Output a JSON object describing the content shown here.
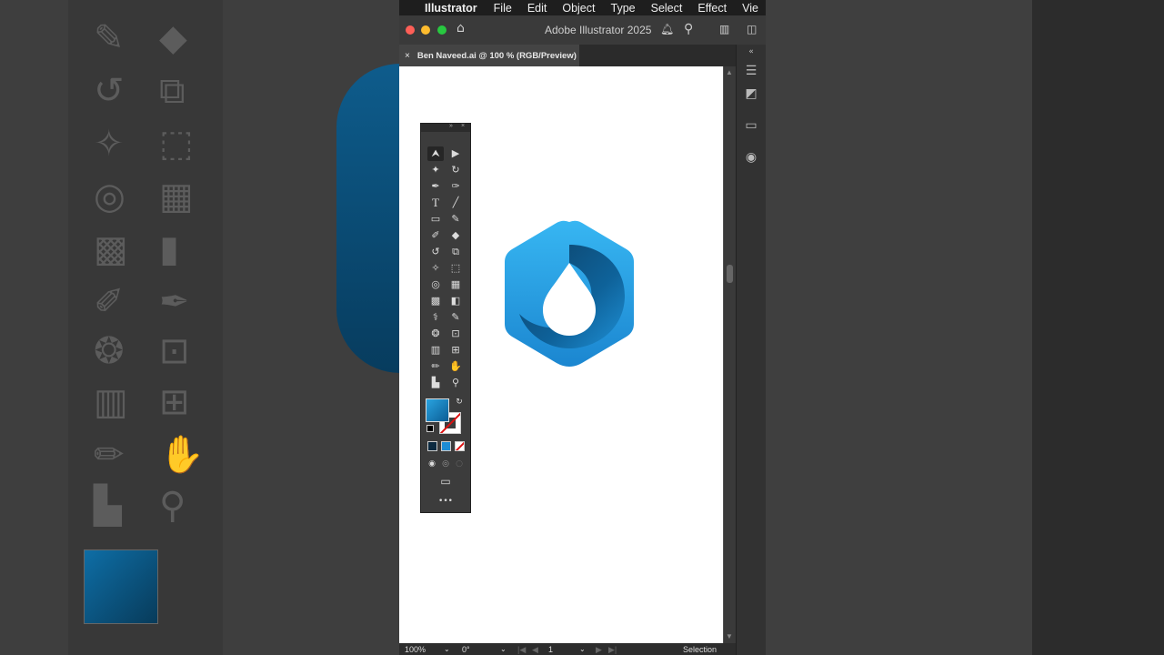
{
  "menubar": {
    "app_name": "Illustrator",
    "items": [
      "File",
      "Edit",
      "Object",
      "Type",
      "Select",
      "Effect",
      "Vie"
    ]
  },
  "window": {
    "title": "Adobe Illustrator 2025",
    "icons": [
      "home-icon",
      "bell-icon",
      "search-icon",
      "arrange-documents-icon",
      "panel-toggle-icon"
    ]
  },
  "document_tab": {
    "close_label": "×",
    "label": "Ben Naveed.ai @ 100 % (RGB/Preview)"
  },
  "status_bar": {
    "zoom": "100%",
    "rotation": "0°",
    "artboard_number": "1",
    "tool_name": "Selection"
  },
  "toolbar": {
    "tools": [
      "selection-tool",
      "direct-selection-tool",
      "magic-wand-tool",
      "lasso-tool",
      "pen-tool",
      "curvature-tool",
      "type-tool",
      "line-segment-tool",
      "rectangle-tool",
      "paintbrush-tool",
      "shaper-tool",
      "eraser-tool",
      "rotate-tool",
      "scale-tool",
      "puppet-warp-tool",
      "free-transform-tool",
      "shape-builder-tool",
      "perspective-grid-tool",
      "mesh-tool",
      "gradient-tool",
      "eyedropper-tool",
      "blend-tool",
      "symbol-sprayer-tool",
      "live-paint-tool",
      "column-graph-tool",
      "artboard-tool",
      "slice-tool",
      "hand-tool",
      "print-tiling-tool",
      "zoom-tool"
    ],
    "more_label": "•••"
  },
  "colors": {
    "logo_light": "#2aa7e8",
    "logo_dark": "#0a3f66",
    "menubar": "#1e1e1e",
    "artboard": "#ffffff"
  }
}
